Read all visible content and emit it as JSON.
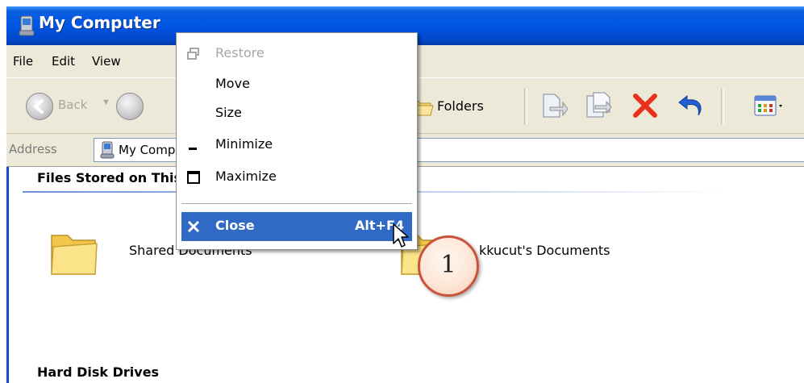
{
  "window": {
    "title": "My Computer",
    "title_icon": "my-computer-icon"
  },
  "menubar": {
    "items": [
      "File",
      "Edit",
      "View"
    ]
  },
  "toolbar": {
    "back_label": "Back",
    "folders_label": "Folders"
  },
  "address": {
    "label": "Address",
    "value": "My Computer"
  },
  "content": {
    "groups": [
      {
        "header": "Files Stored on This Computer",
        "items": [
          "Shared Documents",
          "kkucut's Documents"
        ]
      },
      {
        "header": "Hard Disk Drives"
      }
    ]
  },
  "system_menu": {
    "items": [
      {
        "label": "Restore",
        "enabled": false,
        "icon": "restore-icon"
      },
      {
        "label": "Move",
        "enabled": true
      },
      {
        "label": "Size",
        "enabled": true
      },
      {
        "label": "Minimize",
        "enabled": true,
        "icon": "minimize-icon"
      },
      {
        "label": "Maximize",
        "enabled": true,
        "icon": "maximize-icon"
      },
      {
        "label": "Close",
        "enabled": true,
        "selected": true,
        "accelerator": "Alt+F4",
        "icon": "close-icon"
      }
    ]
  },
  "callout": {
    "number": "1"
  },
  "colors": {
    "title_bar": "#0055e5",
    "menu_highlight": "#316ac5",
    "chrome": "#ece9d8",
    "delete_red": "#e8301c",
    "callout_border": "#c9543b"
  }
}
